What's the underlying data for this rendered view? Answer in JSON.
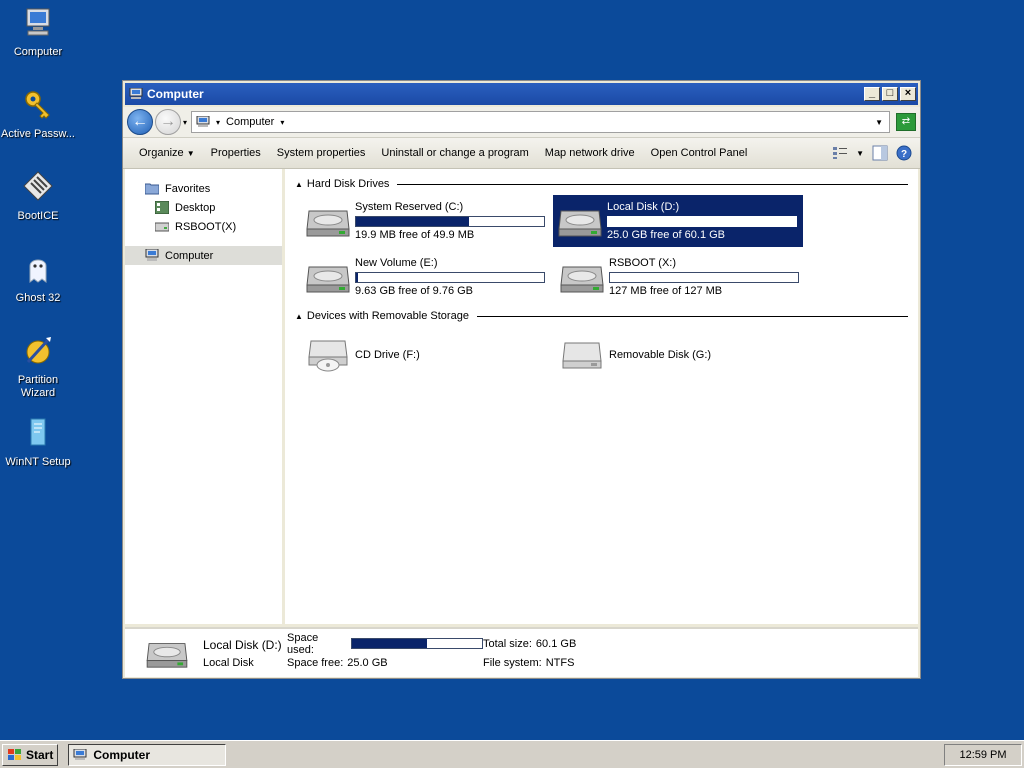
{
  "desktop": {
    "icons": [
      {
        "label": "Computer",
        "icon": "computer-icon"
      },
      {
        "label": "Active Passw...",
        "icon": "key-icon"
      },
      {
        "label": "BootICE",
        "icon": "bootice-icon"
      },
      {
        "label": "Ghost 32",
        "icon": "ghost-icon"
      },
      {
        "label": "Partition Wizard",
        "icon": "partition-wizard-icon"
      },
      {
        "label": "WinNT Setup",
        "icon": "winnt-setup-icon"
      }
    ]
  },
  "window": {
    "title": "Computer",
    "controls": {
      "minimize": "_",
      "maximize": "□",
      "close": "×"
    },
    "address": {
      "location": "Computer"
    },
    "commands": [
      "Organize",
      "Properties",
      "System properties",
      "Uninstall or change a program",
      "Map network drive",
      "Open Control Panel"
    ],
    "nav": {
      "favorites": "Favorites",
      "desktop": "Desktop",
      "rsboot": "RSBOOT(X)",
      "computer": "Computer"
    },
    "groups": {
      "hard_disks": "Hard Disk Drives",
      "removable": "Devices with Removable Storage"
    },
    "drives": [
      {
        "name": "System Reserved (C:)",
        "free_text": "19.9 MB free of 49.9 MB",
        "used_fraction": 0.6
      },
      {
        "name": "Local Disk (D:)",
        "free_text": "25.0 GB free of 60.1 GB",
        "used_fraction": 0.58,
        "selected": true
      },
      {
        "name": "New Volume (E:)",
        "free_text": "9.63 GB free of 9.76 GB",
        "used_fraction": 0.013
      },
      {
        "name": "RSBOOT (X:)",
        "free_text": "127 MB free of 127 MB",
        "used_fraction": 0.0
      }
    ],
    "removable": [
      {
        "name": "CD Drive (F:)"
      },
      {
        "name": "Removable Disk (G:)"
      }
    ],
    "details": {
      "name": "Local Disk (D:)",
      "type": "Local Disk",
      "space_used_label": "Space used:",
      "space_used_fraction": 0.58,
      "space_free_label": "Space free:",
      "space_free": "25.0 GB",
      "total_size_label": "Total size:",
      "total_size": "60.1 GB",
      "filesystem_label": "File system:",
      "filesystem": "NTFS"
    }
  },
  "taskbar": {
    "start": "Start",
    "task": "Computer",
    "clock": "12:59 PM"
  },
  "colors": {
    "desktop": "#0b4a9a",
    "selection": "#0a246a",
    "titlebar": "#1b4aa6"
  }
}
